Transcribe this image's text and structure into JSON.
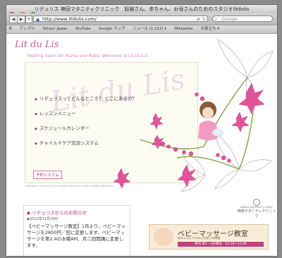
{
  "browser": {
    "title": "リデュリス 神田マタニティクリニック　妊婦さん、赤ちゃん、お母さんのためのスタジオlitdulis",
    "back_label": "◀",
    "forward_label": "▶",
    "add_label": "+",
    "url": "http://www.litdulis.com/",
    "search_placeholder": "Google",
    "bookmarks": [
      "Ⅲ",
      "アップル",
      "Yahoo! Japan",
      "YouTube",
      "Google マップ",
      "ニュース (1,222) ▾",
      "Wikipedia",
      "お役立ち ▾"
    ]
  },
  "page": {
    "logo": "Lit du Lis",
    "tagline": "Healing Salon for Mama and Baby, Welcome to Lit Du Lis",
    "watermark": "Lit du Lis",
    "menu": [
      "リデュリスってどんなところ？ どこにあるの？",
      "レッスンメニュー",
      "スケジュールカレンダー",
      "チャイルドケア託児システム"
    ],
    "booking_label": "予約システム",
    "copyright": "Copyright (C)2010 Lit Du Lis Kanda Maternity Clinic All Rights Reserved.",
    "hospital_en": "KANDA MATERNITY CLINIC",
    "hospital_jp": "神田マタニティクリニック",
    "news": {
      "heading": "リデュリスからのお知らせ",
      "date": "◆2012年11月29日",
      "body": "【ベビーマッサージ教室】1月より、ベビーマッサージを2800円／回に変更します。ベビーマッサージを第2,4の水曜AM、月二回開講に変更します。"
    },
    "banner": {
      "title": "ベビーマッサージ教室",
      "subtitle": "赤ちゃんとママのふれあいの時間",
      "strip": "毎月 第2・4水曜日　10:30〜12:00"
    }
  },
  "colors": {
    "accent_pink": "#c65d93",
    "dark_pink": "#a8306a",
    "lily_pink": "#e0559a"
  }
}
